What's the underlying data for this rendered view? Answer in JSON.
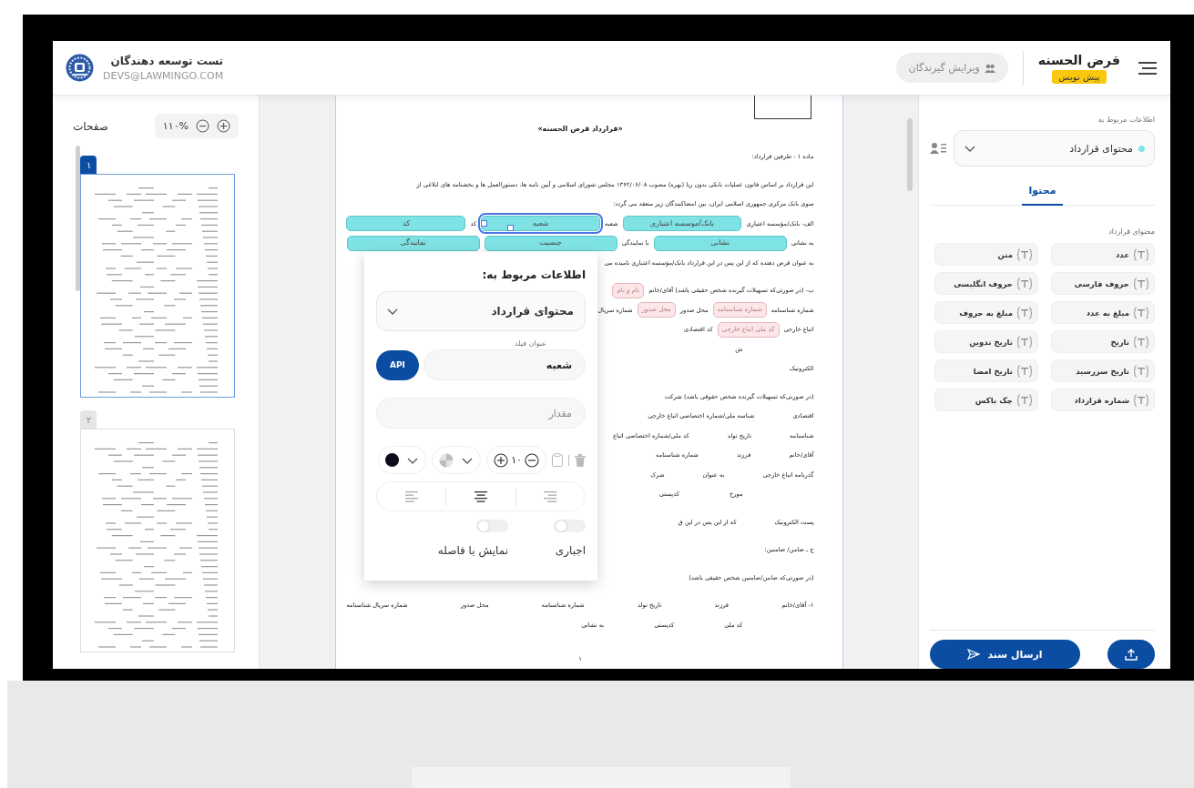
{
  "header": {
    "title": "قرض الحسنه",
    "status_badge": "پیش نویس",
    "edit_recipients_button": {
      "label": "ویرایش گیرندگان",
      "disabled": true
    },
    "user": {
      "name": "تست توسعه دهندگان",
      "email": "DEVS@LAWMINGO.COM"
    }
  },
  "pages_panel": {
    "title": "صفحات",
    "zoom": "۱۱۰%",
    "pages": [
      {
        "number": "۱",
        "selected": true
      },
      {
        "number": "۲",
        "selected": false
      }
    ]
  },
  "document": {
    "lines": [
      {
        "kind": "title",
        "new_paragraph": false,
        "segments": [
          {
            "kind": "text",
            "text": "«قرارداد قرض الحسنه»"
          }
        ]
      },
      {
        "kind": "text",
        "new_paragraph": true,
        "segments": [
          {
            "kind": "text",
            "text": "ماده ۱ - طرفین قرارداد:"
          }
        ]
      },
      {
        "kind": "text",
        "new_paragraph": true,
        "segments": [
          {
            "kind": "text",
            "text": "این قرارداد بر اساس قانون عملیات بانکی بدون ربا (بهره) مصوب ۱۳۶۲/۰۶/۰۸ مجلس شورای اسلامی و آیین نامه ها، دستورالعمل ها و بخشنامه های ابلاغی از"
          }
        ]
      },
      {
        "kind": "text",
        "new_paragraph": false,
        "segments": [
          {
            "kind": "text",
            "text": "سوی بانک مرکزی جمهوری اسلامی ایران، بین امضاکنندگان زیر منعقد می گردد:"
          }
        ]
      },
      {
        "kind": "fill",
        "new_paragraph": false,
        "segments": [
          {
            "kind": "text",
            "text": "الف- بانک/مؤسسه اعتباری"
          },
          {
            "kind": "chip",
            "text": "بانک/موسسه اعتباری",
            "color": "#7fe3e6",
            "selected": false
          },
          {
            "kind": "text",
            "text": "شعبه"
          },
          {
            "kind": "chip",
            "text": "شعبه",
            "color": "#7fe3e6",
            "selected": true
          },
          {
            "kind": "text",
            "text": "کد"
          },
          {
            "kind": "chip",
            "text": "کد",
            "color": "#7fe3e6",
            "selected": false
          }
        ]
      },
      {
        "kind": "fill",
        "new_paragraph": false,
        "segments": [
          {
            "kind": "text",
            "text": "به نشانی"
          },
          {
            "kind": "chip",
            "text": "نشانی",
            "color": "#7fe3e6",
            "selected": false
          },
          {
            "kind": "text",
            "text": "با نمایندگی"
          },
          {
            "kind": "chip",
            "text": "جنسیت",
            "color": "#7fe3e6",
            "selected": false
          },
          {
            "kind": "chip",
            "text": "نمایندگی",
            "color": "#7fe3e6",
            "selected": false
          }
        ]
      },
      {
        "kind": "text",
        "new_paragraph": false,
        "segments": [
          {
            "kind": "text",
            "text": "به عنوان قرض دهنده که از این پس در این قرارداد بانک/مؤسسه اعتباری نامیده می"
          }
        ]
      },
      {
        "kind": "text",
        "new_paragraph": true,
        "segments": [
          {
            "kind": "text",
            "text": "ب- (در صورتی‌که تسهیلات گیرنده شخص حقیقی باشد) آقای/خانم"
          },
          {
            "kind": "chip",
            "text": "نام و نام",
            "color": "#fde6e8",
            "selected": false
          }
        ]
      },
      {
        "kind": "text",
        "new_paragraph": false,
        "segments": [
          {
            "kind": "text",
            "text": "شماره شناسنامه"
          },
          {
            "kind": "chip",
            "text": "شماره شناسنامه",
            "color": "#fde6e8",
            "selected": false
          },
          {
            "kind": "text",
            "text": "محل صدور"
          },
          {
            "kind": "chip",
            "text": "محل صدور",
            "color": "#fde6e8",
            "selected": false
          },
          {
            "kind": "text",
            "text": "شماره سریال"
          }
        ]
      },
      {
        "kind": "text",
        "new_paragraph": false,
        "segments": [
          {
            "kind": "text",
            "text": "اتباع خارجی"
          },
          {
            "kind": "chip",
            "text": "کد ملی اتباع خارجی",
            "color": "#fde6e8",
            "selected": false
          },
          {
            "kind": "text",
            "text": "کد اقتصادی"
          }
        ]
      },
      {
        "kind": "indent_row",
        "new_paragraph": false,
        "segments": [
          {
            "kind": "text",
            "text": "ش"
          }
        ]
      },
      {
        "kind": "text",
        "new_paragraph": false,
        "segments": [
          {
            "kind": "text",
            "text": "الکترونیک"
          }
        ]
      },
      {
        "kind": "text",
        "new_paragraph": true,
        "segments": [
          {
            "kind": "text",
            "text": "(در صورتی‌که تسهیلات گیرنده شخص حقوقی باشد) شرکت"
          }
        ]
      },
      {
        "kind": "row",
        "new_paragraph": false,
        "segments": [
          {
            "kind": "text",
            "text": "اقتصادی"
          },
          {
            "kind": "text",
            "text": "شناسه ملی/شماره اختصاصی اتباع خارجی"
          }
        ]
      },
      {
        "kind": "row",
        "new_paragraph": false,
        "segments": [
          {
            "kind": "text",
            "text": "شناسنامه"
          },
          {
            "kind": "text",
            "text": "تاریخ تولد"
          },
          {
            "kind": "text",
            "text": "کد ملی/شماره اختصاصی اتباع"
          }
        ]
      },
      {
        "kind": "row",
        "new_paragraph": false,
        "segments": [
          {
            "kind": "text",
            "text": "آقای/خانم"
          },
          {
            "kind": "text",
            "text": "فرزند"
          },
          {
            "kind": "text",
            "text": "شماره شناسنامه"
          }
        ]
      },
      {
        "kind": "row",
        "new_paragraph": false,
        "segments": [
          {
            "kind": "text",
            "text": "گذرنامه اتباع خارجی"
          },
          {
            "kind": "text",
            "text": "به عنوان"
          },
          {
            "kind": "text",
            "text": "شرک"
          }
        ]
      },
      {
        "kind": "indent_row",
        "new_paragraph": false,
        "segments": [
          {
            "kind": "text",
            "text": "مورخ"
          },
          {
            "kind": "text",
            "text": "کدپستی"
          }
        ]
      },
      {
        "kind": "row",
        "new_paragraph": true,
        "segments": [
          {
            "kind": "text",
            "text": "پست الکترونیک"
          },
          {
            "kind": "text",
            "text": "که از این پس در این ق"
          }
        ]
      },
      {
        "kind": "text",
        "new_paragraph": true,
        "segments": [
          {
            "kind": "text",
            "text": "ج ـ ضامن/ ضامنین:"
          }
        ]
      },
      {
        "kind": "text",
        "new_paragraph": true,
        "segments": [
          {
            "kind": "text",
            "text": "(در صورتی‌که ضامن/ضامنین شخص حقیقی باشد)"
          }
        ]
      },
      {
        "kind": "spread",
        "new_paragraph": true,
        "segments": [
          {
            "kind": "text",
            "text": "۱- آقای/خانم"
          },
          {
            "kind": "text",
            "text": "فرزند"
          },
          {
            "kind": "text",
            "text": "تاریخ تولد"
          },
          {
            "kind": "text",
            "text": "شماره شناسنامه"
          },
          {
            "kind": "text",
            "text": "محل صدور"
          },
          {
            "kind": "text",
            "text": "شماره سریال شناسنامه"
          }
        ]
      },
      {
        "kind": "indent_row",
        "new_paragraph": false,
        "segments": [
          {
            "kind": "text",
            "text": "کد ملی"
          },
          {
            "kind": "text",
            "text": "کدپستی"
          },
          {
            "kind": "text",
            "text": "به نشانی"
          }
        ]
      }
    ],
    "page_number": "۱"
  },
  "popup": {
    "title": "اطلاعات مربوط به:",
    "source_select": "محتوای قرارداد",
    "field_title": {
      "label": "عنوان فیلد",
      "value": "شعبه"
    },
    "api_button": "API",
    "value_field": {
      "placeholder": "مقدار"
    },
    "font_size": "۱۰",
    "alignments": [
      {
        "kind": "right",
        "selected": false
      },
      {
        "kind": "center",
        "selected": true
      },
      {
        "kind": "left",
        "selected": false
      }
    ],
    "toggles": [
      {
        "label": "اجباری",
        "on": false
      },
      {
        "label": "نمایش با فاصله",
        "on": false
      }
    ]
  },
  "sidebar": {
    "related_label": "اطلاعات مربوط به",
    "source_select": {
      "label": "محتوای قرارداد",
      "color": "#7fe3e6"
    },
    "tabs": [
      {
        "label": "محتوا",
        "selected": true
      }
    ],
    "section_title": "محتوای قرارداد",
    "fields": [
      {
        "label": "عدد"
      },
      {
        "label": "متن"
      },
      {
        "label": "حروف فارسی"
      },
      {
        "label": "حروف انگلیسی"
      },
      {
        "label": "مبلغ به عدد"
      },
      {
        "label": "مبلغ به حروف"
      },
      {
        "label": "تاریخ"
      },
      {
        "label": "تاریخ تدوین"
      },
      {
        "label": "تاریخ سررسید"
      },
      {
        "label": "تاریخ امضا"
      },
      {
        "label": "شماره قرارداد"
      },
      {
        "label": "چک باکس"
      }
    ],
    "send_button": "ارسال سند"
  }
}
